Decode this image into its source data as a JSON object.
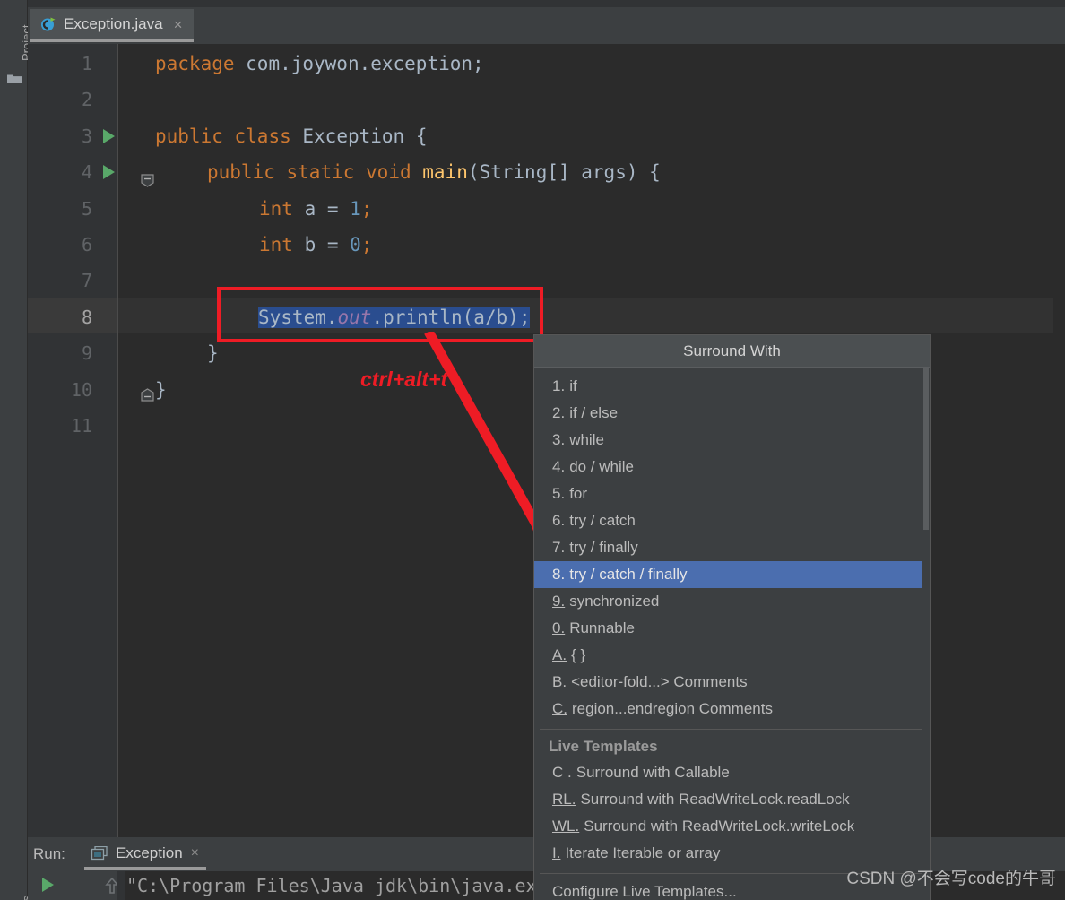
{
  "window": {
    "left_tool_top_label": "Project",
    "left_tool_bottom_label": "ks",
    "folder_icon": "folder-icon"
  },
  "tab": {
    "label": "Exception.java",
    "close": "×",
    "icon": "java-class-icon"
  },
  "editor": {
    "lines": [
      {
        "n": "1",
        "run": false,
        "fold": "",
        "current": false
      },
      {
        "n": "2",
        "run": false,
        "fold": "",
        "current": false
      },
      {
        "n": "3",
        "run": true,
        "fold": "",
        "current": false
      },
      {
        "n": "4",
        "run": true,
        "fold": "open",
        "current": false
      },
      {
        "n": "5",
        "run": false,
        "fold": "",
        "current": false
      },
      {
        "n": "6",
        "run": false,
        "fold": "",
        "current": false
      },
      {
        "n": "7",
        "run": false,
        "fold": "",
        "current": false
      },
      {
        "n": "8",
        "run": false,
        "fold": "",
        "current": true
      },
      {
        "n": "9",
        "run": false,
        "fold": "close",
        "current": false
      },
      {
        "n": "10",
        "run": false,
        "fold": "",
        "current": false
      },
      {
        "n": "11",
        "run": false,
        "fold": "",
        "current": false
      }
    ],
    "code": {
      "l1_kw": "package",
      "l1_rest": " com.joywon.exception;",
      "l3_kw1": "public",
      "l3_kw2": "class",
      "l3_name": "Exception",
      "l3_brace": "{",
      "l4_kw1": "public",
      "l4_kw2": "static",
      "l4_kw3": "void",
      "l4_fn": "main",
      "l4_sig": "(String[] args) {",
      "l5_kw": "int",
      "l5_mid": " a = ",
      "l5_num": "1",
      "l5_end": ";",
      "l6_kw": "int",
      "l6_mid": " b = ",
      "l6_num": "0",
      "l6_end": ";",
      "l8_a": "System.",
      "l8_b": "out",
      "l8_c": ".println(a/b);",
      "l9": "}",
      "l10": "}"
    }
  },
  "annotation": {
    "shortcut_text": "ctrl+alt+t",
    "box_color": "#ee1c25",
    "arrow_color": "#ee1c25"
  },
  "popup": {
    "title": "Surround With",
    "items": [
      {
        "mnemonic": "1.",
        "underline": false,
        "label": "if",
        "selected": false
      },
      {
        "mnemonic": "2.",
        "underline": false,
        "label": "if / else",
        "selected": false
      },
      {
        "mnemonic": "3.",
        "underline": false,
        "label": "while",
        "selected": false
      },
      {
        "mnemonic": "4.",
        "underline": false,
        "label": "do / while",
        "selected": false
      },
      {
        "mnemonic": "5.",
        "underline": false,
        "label": "for",
        "selected": false
      },
      {
        "mnemonic": "6.",
        "underline": false,
        "label": "try / catch",
        "selected": false
      },
      {
        "mnemonic": "7.",
        "underline": false,
        "label": "try / finally",
        "selected": false
      },
      {
        "mnemonic": "8.",
        "underline": false,
        "label": "try / catch / finally",
        "selected": true
      },
      {
        "mnemonic": "9.",
        "underline": true,
        "label": "synchronized",
        "selected": false
      },
      {
        "mnemonic": "0.",
        "underline": true,
        "label": "Runnable",
        "selected": false
      },
      {
        "mnemonic": "A.",
        "underline": true,
        "label": "{ }",
        "selected": false
      },
      {
        "mnemonic": "B.",
        "underline": true,
        "label": "<editor-fold...> Comments",
        "selected": false
      },
      {
        "mnemonic": "C.",
        "underline": true,
        "label": "region...endregion Comments",
        "selected": false
      }
    ],
    "group_title": "Live Templates",
    "template_items": [
      {
        "mnemonic": "C .",
        "underline": false,
        "label": "Surround with Callable"
      },
      {
        "mnemonic": "RL.",
        "underline": true,
        "label": "Surround with ReadWriteLock.readLock"
      },
      {
        "mnemonic": "WL.",
        "underline": true,
        "label": "Surround with ReadWriteLock.writeLock"
      },
      {
        "mnemonic": "I.",
        "underline": true,
        "label": "Iterate Iterable or array"
      }
    ],
    "footer": "Configure Live Templates...",
    "selection_color": "#4b6eaf"
  },
  "run_panel": {
    "label": "Run:",
    "tab_label": "Exception",
    "tab_close": "×",
    "console_text": "\"C:\\Program Files\\Java_jdk\\bin\\java.ex"
  },
  "watermark": {
    "text": "CSDN @不会写code的牛哥"
  }
}
